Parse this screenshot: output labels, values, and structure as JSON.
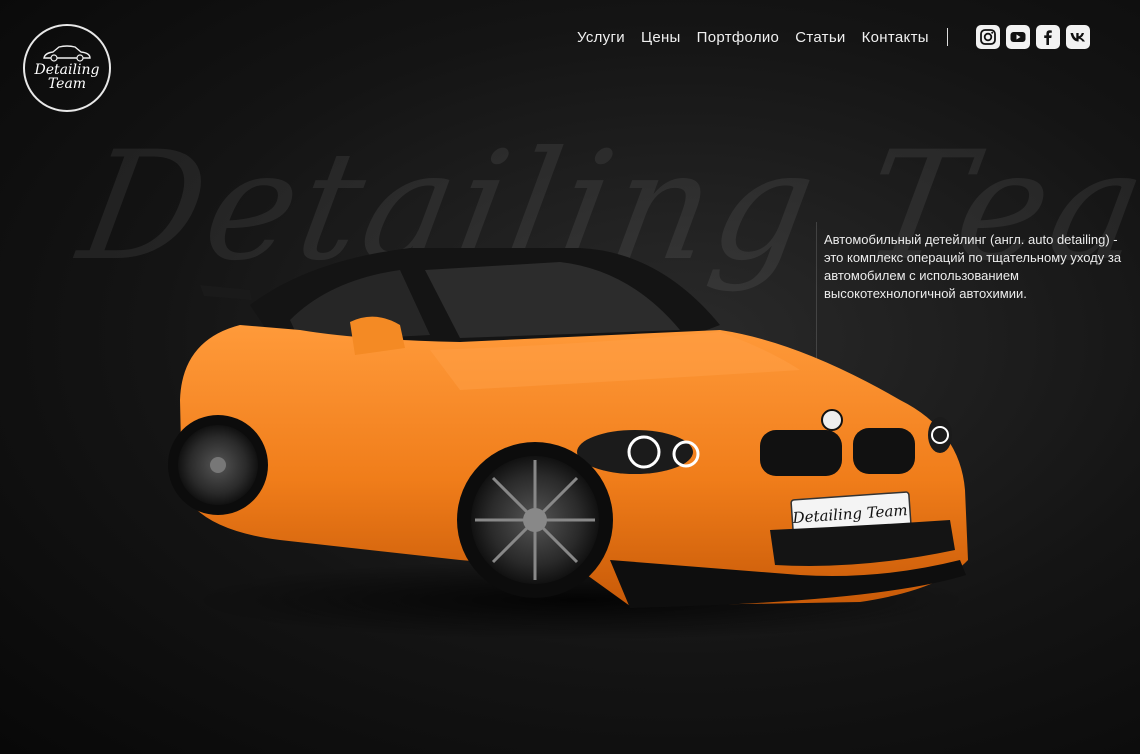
{
  "logo": {
    "line1": "Detailing",
    "line2": "Team"
  },
  "nav": {
    "items": [
      "Услуги",
      "Цены",
      "Портфолио",
      "Статьи",
      "Контакты"
    ]
  },
  "socials": [
    "instagram-icon",
    "youtube-icon",
    "facebook-icon",
    "vk-icon"
  ],
  "watermark": "Detailing Team",
  "description": "Автомобильный детейлинг (англ. auto detailing)  - это комплекс операций по тщательному уходу за автомобилем с использованием высокотехнологичной автохимии.",
  "plate": "Detailing Team",
  "colors": {
    "car": "#f07d1a",
    "background": "#141414",
    "text": "#ececec"
  }
}
